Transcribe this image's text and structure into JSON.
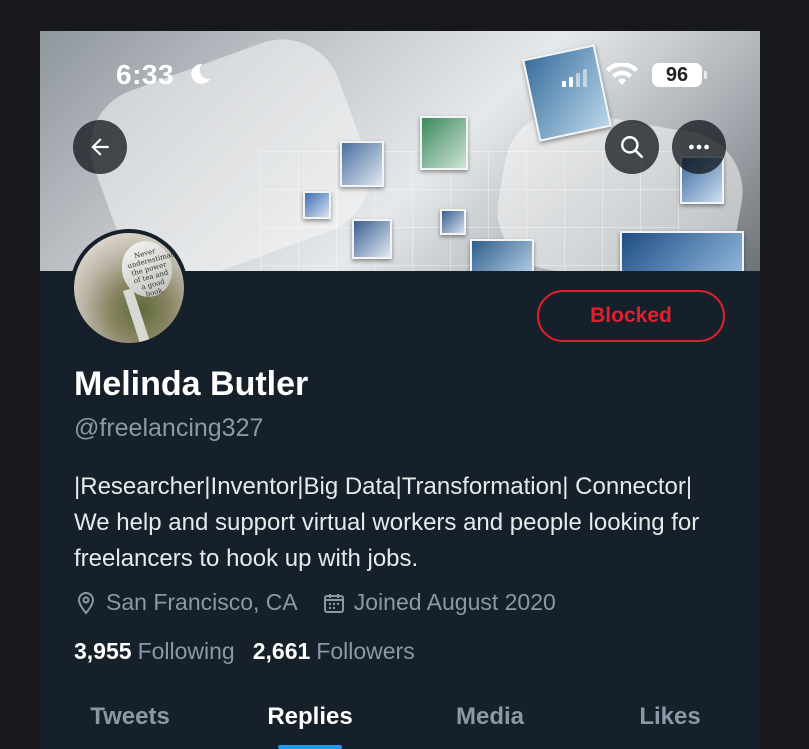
{
  "status_bar": {
    "time": "6:33",
    "battery": "96"
  },
  "profile": {
    "name": "Melinda Butler",
    "handle": "@freelancing327",
    "bio": "|Researcher|Inventor|Big Data|Transformation| Connector| We help and support virtual workers and people looking for freelancers to hook up with jobs.",
    "location": "San Francisco, CA",
    "joined": "Joined August 2020",
    "following_count": "3,955",
    "following_label": "Following",
    "followers_count": "2,661",
    "followers_label": "Followers",
    "blocked_label": "Blocked",
    "avatar_spoon_text": "Never underestimate the power of tea and a good book."
  },
  "tabs": [
    {
      "label": "Tweets",
      "active": false
    },
    {
      "label": "Replies",
      "active": true
    },
    {
      "label": "Media",
      "active": false
    },
    {
      "label": "Likes",
      "active": false
    }
  ],
  "colors": {
    "background": "#15202b",
    "accent": "#1d9bf0",
    "blocked": "#f4212e",
    "secondary_text": "#8b98a5"
  }
}
